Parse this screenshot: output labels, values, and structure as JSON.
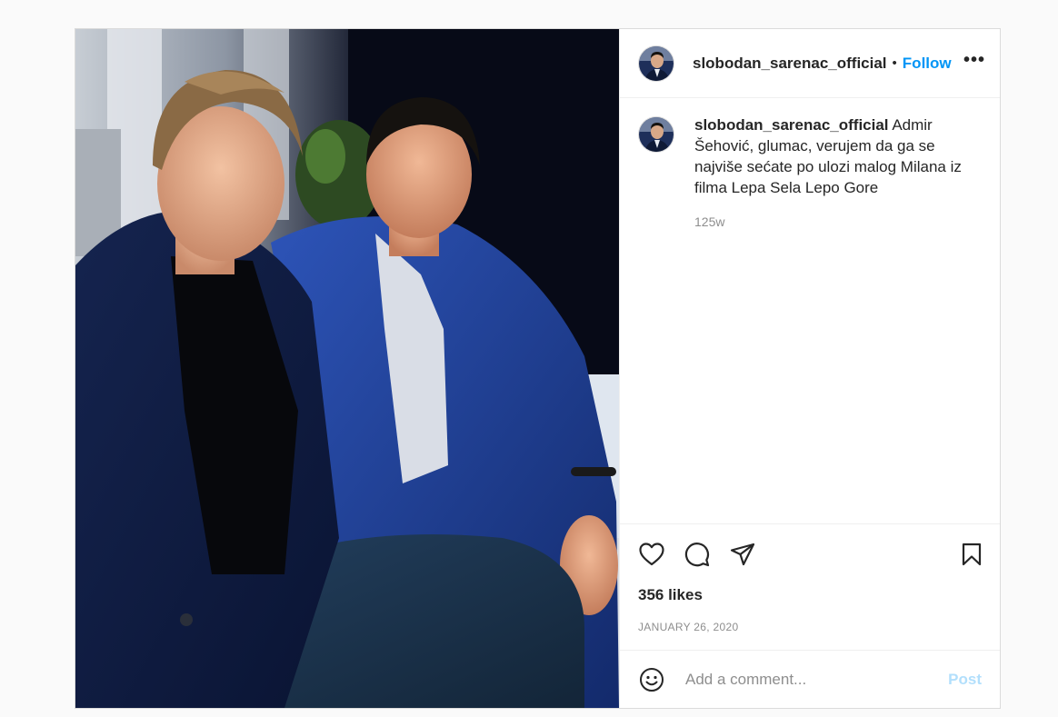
{
  "post": {
    "username": "slobodan_sarenac_official",
    "separator": "•",
    "follow_label": "Follow",
    "more_label": "•••",
    "caption_user": "slobodan_sarenac_official",
    "caption_text": "Admir Šehović, glumac, verujem da ga se najviše sećate po ulozi malog Milana iz filma Lepa Sela Lepo Gore",
    "time_ago": "125w",
    "likes": "356 likes",
    "date": "JANUARY 26, 2020"
  },
  "comment_box": {
    "placeholder": "Add a comment...",
    "post_label": "Post"
  },
  "icons": {
    "like": "heart-icon",
    "comment": "comment-bubble-icon",
    "share": "paper-plane-icon",
    "save": "bookmark-icon",
    "emoji": "smiley-icon"
  },
  "colors": {
    "accent": "#0095f6",
    "post_disabled": "#b2dffc",
    "muted": "#8e8e8e",
    "border": "#dbdbdb"
  }
}
